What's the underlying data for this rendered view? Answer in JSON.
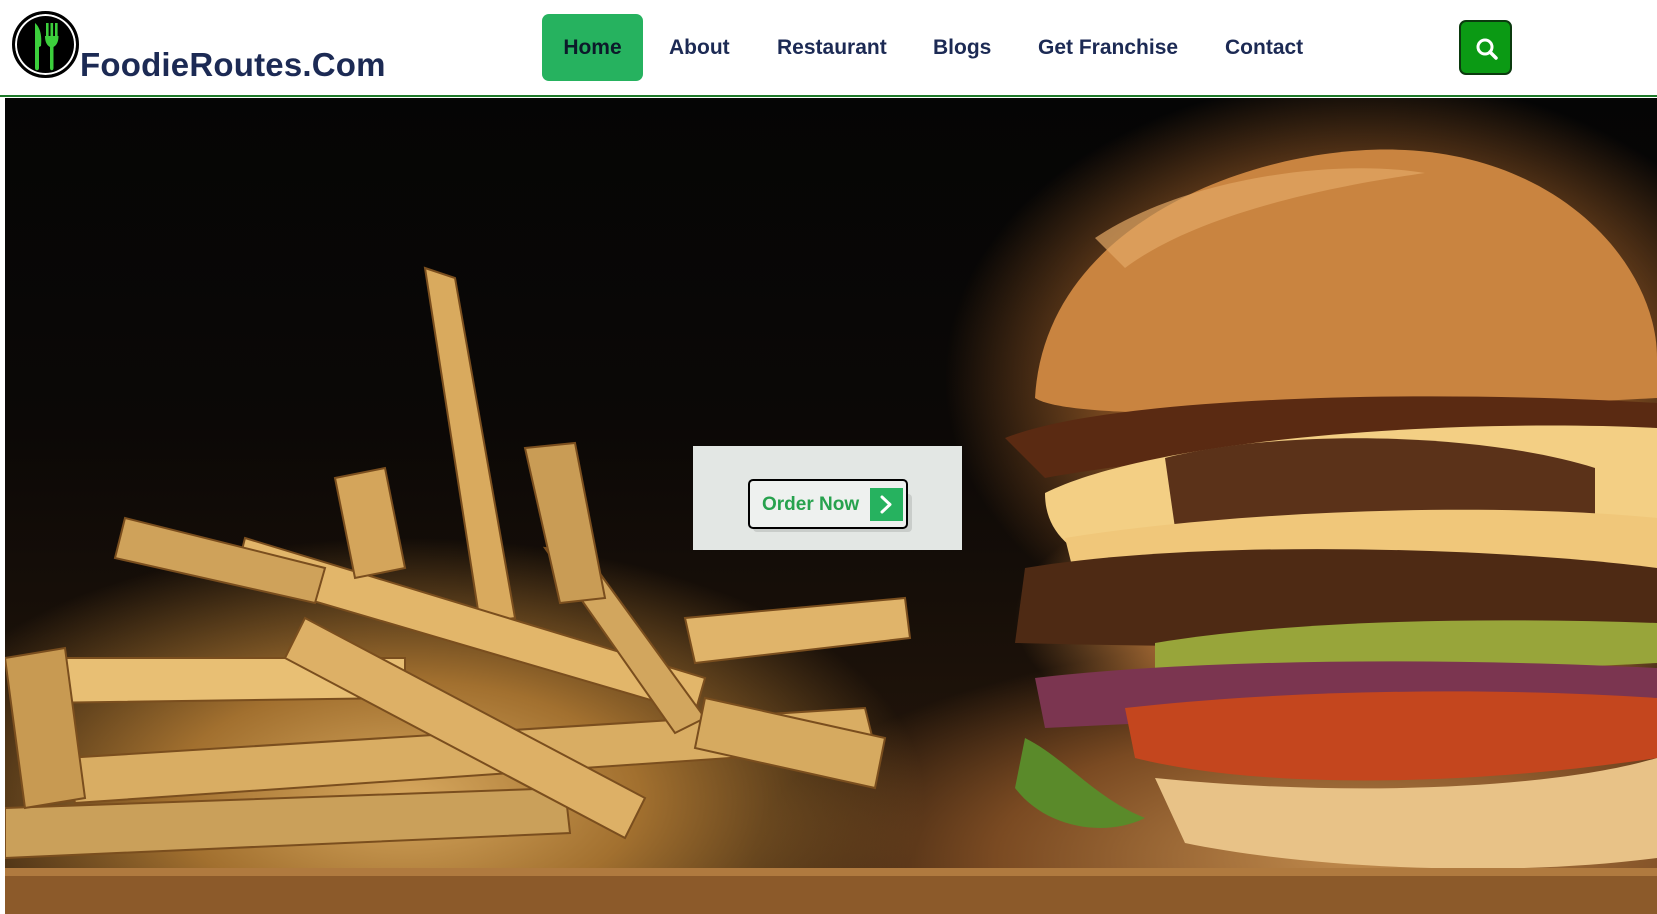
{
  "brand": {
    "name": "FoodieRoutes.Com",
    "logo_icon": "fork-knife-icon",
    "accent_color": "#3ccf3c"
  },
  "nav": {
    "items": [
      {
        "label": "Home",
        "active": true
      },
      {
        "label": "About",
        "active": false
      },
      {
        "label": "Restaurant",
        "active": false
      },
      {
        "label": "Blogs",
        "active": false
      },
      {
        "label": "Get Franchise",
        "active": false
      },
      {
        "label": "Contact",
        "active": false
      }
    ],
    "active_color": "#26b25f",
    "text_color": "#1c2a54"
  },
  "search": {
    "icon": "search-icon",
    "color": "#0b9a14"
  },
  "hero": {
    "image": "burger-and-fries-photo",
    "cta": {
      "label": "Order Now",
      "icon": "chevron-right-icon",
      "color": "#27a24e"
    }
  }
}
